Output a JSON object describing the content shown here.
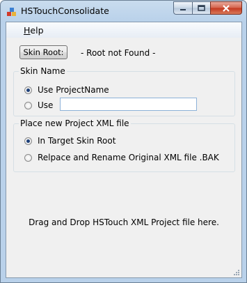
{
  "window": {
    "title": "HSTouchConsolidate"
  },
  "icons": {
    "app": "app-icon",
    "minimize": "minimize-icon",
    "maximize": "maximize-icon",
    "close": "close-icon",
    "size_grip": "size-grip-icon"
  },
  "menu": {
    "help": "Help"
  },
  "skin_root": {
    "button_label": "Skin Root:",
    "status": "- Root not Found -"
  },
  "skin_name": {
    "legend": "Skin Name",
    "option_project": "Use ProjectName",
    "option_use": "Use",
    "custom_value": "",
    "selected": "option_project"
  },
  "xml_placement": {
    "legend": "Place new Project XML file",
    "option_target": "In Target Skin Root",
    "option_replace": "Relpace and Rename Original XML file .BAK",
    "selected": "option_target"
  },
  "drop_hint": "Drag and Drop HSTouch XML Project file here."
}
